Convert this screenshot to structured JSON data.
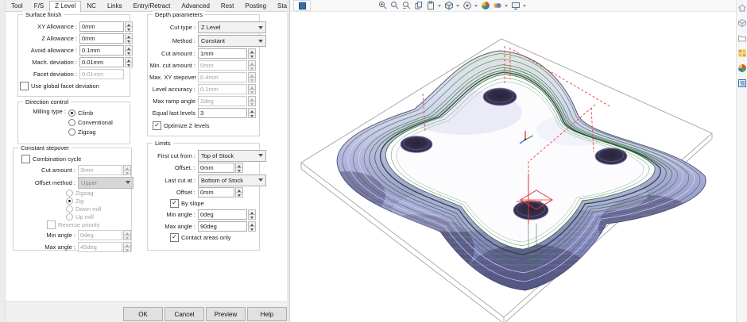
{
  "dialog": {
    "tabs": {
      "items": [
        "Tool",
        "F/S",
        "Z Level",
        "NC",
        "Links",
        "Entry/Retract",
        "Advanced",
        "Rest",
        "Posting",
        "Statistics"
      ],
      "active": "Z Level"
    },
    "surface_finish": {
      "title": "Surface finish",
      "rows": [
        {
          "label": "XY Allowance :",
          "value": "0mm"
        },
        {
          "label": "Z Allowance :",
          "value": "0mm"
        },
        {
          "label": "Avoid allowance :",
          "value": "0.1mm"
        },
        {
          "label": "Mach. deviation :",
          "value": "0.01mm"
        },
        {
          "label": "Facet deviation :",
          "value": "0.01mm"
        }
      ],
      "checkbox": "Use global facet deviation"
    },
    "direction_control": {
      "title": "Direction control",
      "label": "Milling type :",
      "options": [
        "Climb",
        "Conventional",
        "Zigzag"
      ],
      "selected": "Climb"
    },
    "constant_stepover": {
      "title": "Constant stepover",
      "combination_cycle": "Combination cycle",
      "cut_amount_label": "Cut amount :",
      "cut_amount_value": "3mm",
      "offset_method_label": "Offset method :",
      "offset_method_value": "Upper",
      "options": [
        "Zigzag",
        "Zig",
        "Down mill",
        "Up mill"
      ],
      "selected": "Zig",
      "reverse_priority": "Reverse priority",
      "min_angle_label": "Min angle :",
      "min_angle_value": "0deg",
      "max_angle_label": "Max angle :",
      "max_angle_value": "45deg"
    },
    "depth_parameters": {
      "title": "Depth parameters",
      "cut_type_label": "Cut type :",
      "cut_type_value": "Z Level",
      "method_label": "Method :",
      "method_value": "Constant",
      "rows": [
        {
          "label": "Cut amount :",
          "value": "1mm"
        },
        {
          "label": "Min. cut amount :",
          "value": "0mm"
        },
        {
          "label": "Max. XY stepover :",
          "value": "0.4mm"
        },
        {
          "label": "Level accuracy :",
          "value": "0.1mm"
        },
        {
          "label": "Max ramp angle",
          "value": "2deg"
        },
        {
          "label": "Equal last levels",
          "value": "3"
        }
      ],
      "optimize": "Optimize Z levels"
    },
    "limits": {
      "title": "Limits",
      "first_cut_label": "First cut from :",
      "first_cut_value": "Top of Stock",
      "offset1_label": "Offset. :",
      "offset1_value": "0mm",
      "last_cut_label": "Last cut at :",
      "last_cut_value": "Bottom of Stock",
      "offset2_label": "Offset :",
      "offset2_value": "0mm",
      "by_slope": "By slope",
      "min_angle_label": "Min angle :",
      "min_angle_value": "0deg",
      "max_angle_label": "Max angle :",
      "max_angle_value": "90deg",
      "contact": "Contact areas only"
    },
    "buttons": {
      "ok": "OK",
      "cancel": "Cancel",
      "preview": "Preview",
      "help": "Help"
    }
  },
  "viewport": {
    "toolbar_icons": [
      "stop",
      "zoom-in",
      "zoom-window",
      "zoom-dynamic",
      "copy",
      "paste",
      "shade-mode",
      "visibility",
      "render",
      "material",
      "display"
    ],
    "side_icons": [
      "home",
      "stock-box",
      "folder",
      "fixture",
      "colors",
      "operation-tree"
    ],
    "colors": {
      "toolpath_green": "#2f6b2f",
      "rapid_red": "#e04040",
      "body_purple": "#9a9ad0",
      "hole_dark": "#2e2a48",
      "stock_outline": "#9a9a9a"
    }
  }
}
